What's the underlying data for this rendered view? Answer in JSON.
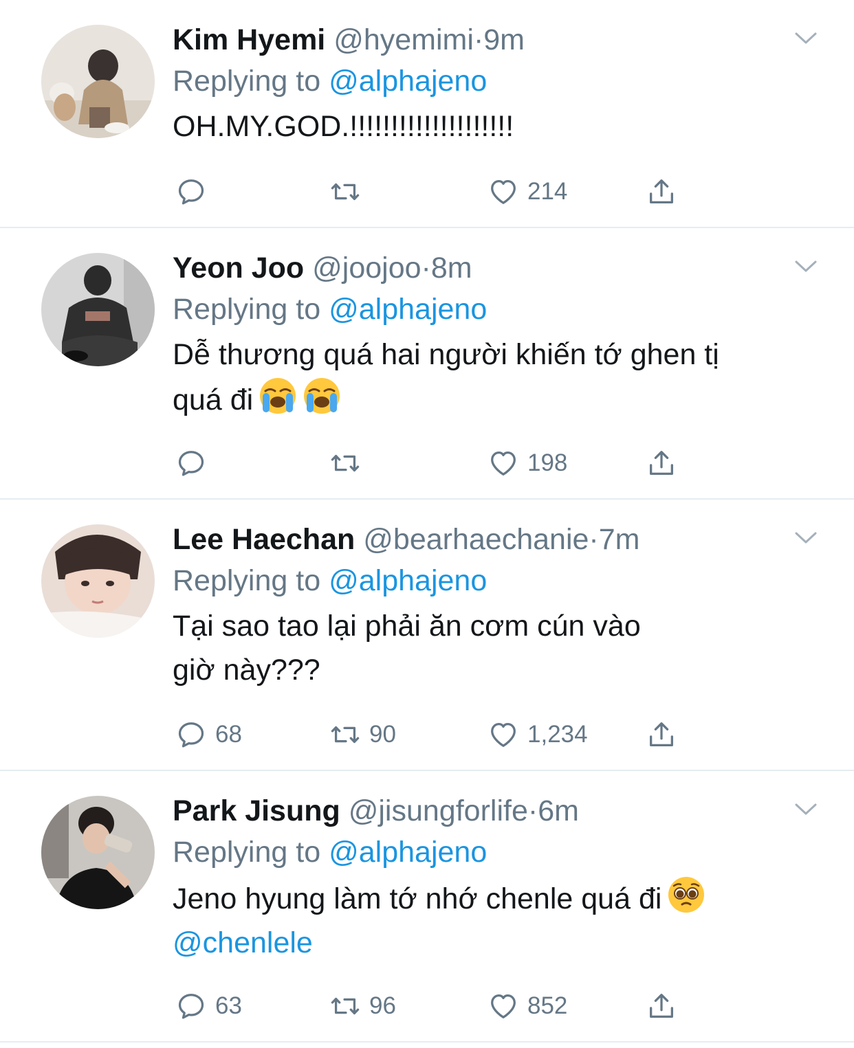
{
  "colors": {
    "link": "#1b95e0",
    "secondary": "#657786",
    "divider": "#e6ecf0"
  },
  "tweets": [
    {
      "name": "Kim Hyemi",
      "handle": "@hyemimi",
      "dot": "·",
      "time": "9m",
      "replying_label": "Replying to",
      "replying_to": "@alphajeno",
      "text_line1": "OH.MY.GOD.!!!!!!!!!!!!!!!!!!!!",
      "text_line2": "",
      "reply_count": "",
      "retweet_count": "",
      "like_count": "214"
    },
    {
      "name": "Yeon Joo",
      "handle": "@joojoo",
      "dot": "·",
      "time": "8m",
      "replying_label": "Replying to",
      "replying_to": "@alphajeno",
      "text_line1": "Dễ thương quá hai người khiến tớ ghen tị",
      "text_line2": "quá đi",
      "emoji": [
        "loudly-crying-face",
        "loudly-crying-face"
      ],
      "reply_count": "",
      "retweet_count": "",
      "like_count": "198"
    },
    {
      "name": "Lee Haechan",
      "handle": "@bearhaechanie",
      "dot": "·",
      "time": "7m",
      "replying_label": "Replying to",
      "replying_to": "@alphajeno",
      "text_line1": "Tại sao tao lại phải ăn cơm cún vào",
      "text_line2": "giờ này???",
      "reply_count": "68",
      "retweet_count": "90",
      "like_count": "1,234"
    },
    {
      "name": "Park Jisung",
      "handle": "@jisungforlife",
      "dot": "·",
      "time": "6m",
      "replying_label": "Replying to",
      "replying_to": "@alphajeno",
      "text_line1": "Jeno hyung làm tớ nhớ chenle quá đi",
      "text_line2": "@chenlele",
      "emoji": [
        "pleading-face"
      ],
      "reply_count": "63",
      "retweet_count": "96",
      "like_count": "852"
    }
  ]
}
